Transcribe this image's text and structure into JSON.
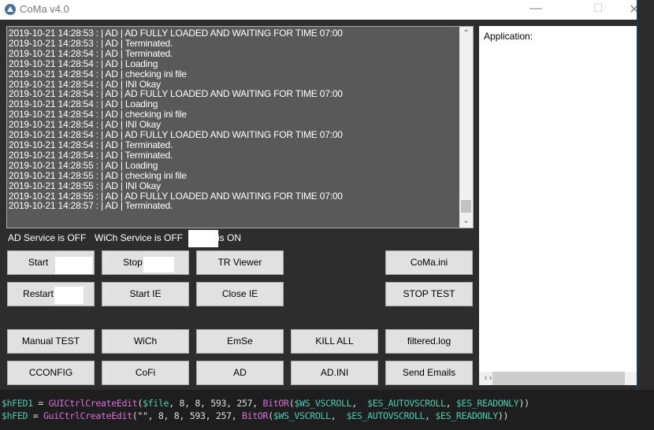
{
  "window": {
    "title": "CoMa  v4.0"
  },
  "log": {
    "lines": [
      "2019-10-21 14:28:53 : | AD | AD FULLY LOADED AND WAITING FOR TIME 07:00",
      "2019-10-21 14:28:53 : | AD | Terminated.",
      "2019-10-21 14:28:54 : | AD | Terminated.",
      "2019-10-21 14:28:54 : | AD | Loading",
      "2019-10-21 14:28:54 : | AD | checking ini file",
      "2019-10-21 14:28:54 : | AD | INI Okay",
      "2019-10-21 14:28:54 : | AD | AD FULLY LOADED AND WAITING FOR TIME 07:00",
      "2019-10-21 14:28:54 : | AD | Loading",
      "2019-10-21 14:28:54 : | AD | checking ini file",
      "2019-10-21 14:28:54 : | AD | INI Okay",
      "2019-10-21 14:28:54 : | AD | AD FULLY LOADED AND WAITING FOR TIME 07:00",
      "2019-10-21 14:28:54 : | AD | Terminated.",
      "2019-10-21 14:28:54 : | AD | Terminated.",
      "2019-10-21 14:28:55 : | AD | Loading",
      "2019-10-21 14:28:55 : | AD | checking ini file",
      "2019-10-21 14:28:55 : | AD | INI Okay",
      "2019-10-21 14:28:55 : | AD | AD FULLY LOADED AND WAITING FOR TIME 07:00",
      "2019-10-21 14:28:57 : | AD | Terminated."
    ]
  },
  "status": {
    "ad": "AD Service is OFF",
    "wich": "WiCh Service is OFF",
    "third": "is ON"
  },
  "buttons": {
    "start": "Start",
    "stop": "Stop",
    "tr_viewer": "TR Viewer",
    "coma_ini": "CoMa.ini",
    "restart": "Restart",
    "start_ie": "Start IE",
    "close_ie": "Close IE",
    "stop_test": "STOP TEST",
    "manual_test": "Manual TEST",
    "wich": "WiCh",
    "emse": "EmSe",
    "kill_all": "KILL ALL",
    "filtered_log": "filtered.log",
    "cconfig": "CCONFIG",
    "cofi": "CoFi",
    "ad": "AD",
    "ad_ini": "AD.INI",
    "send_emails": "Send Emails"
  },
  "app_panel": {
    "label": "Application:"
  },
  "code": {
    "line1": {
      "var": "$hFED1",
      "eq": " = ",
      "fn": "GUICtrlCreateEdit",
      "p1": "(",
      "a1": "$file",
      "mid": ", 8, 8, 593, 257, ",
      "fn2": "BitOR",
      "p2": "(",
      "c1": "$WS_VSCROLL",
      "s1": ",  ",
      "c2": "$ES_AUTOVSCROLL",
      "s2": ", ",
      "c3": "$ES_READONLY",
      "end": "))"
    },
    "line2": {
      "var": "$hFED",
      "eq": " = ",
      "fn": "GuiCtrlCreateEdit",
      "p1": "(\"\"",
      "mid": ", 8, 8, 593, 257, ",
      "fn2": "BitOR",
      "p2": "(",
      "c1": "$WS_VSCROLL",
      "s1": ",  ",
      "c2": "$ES_AUTOVSCROLL",
      "s2": ", ",
      "c3": "$ES_READONLY",
      "end": "))"
    }
  },
  "colors": {
    "window_bg": "#2d2d2d",
    "log_bg": "#595959",
    "button_bg": "#e1e1e1",
    "code_var": "#4ec9b0",
    "code_fn": "#d670d6"
  }
}
